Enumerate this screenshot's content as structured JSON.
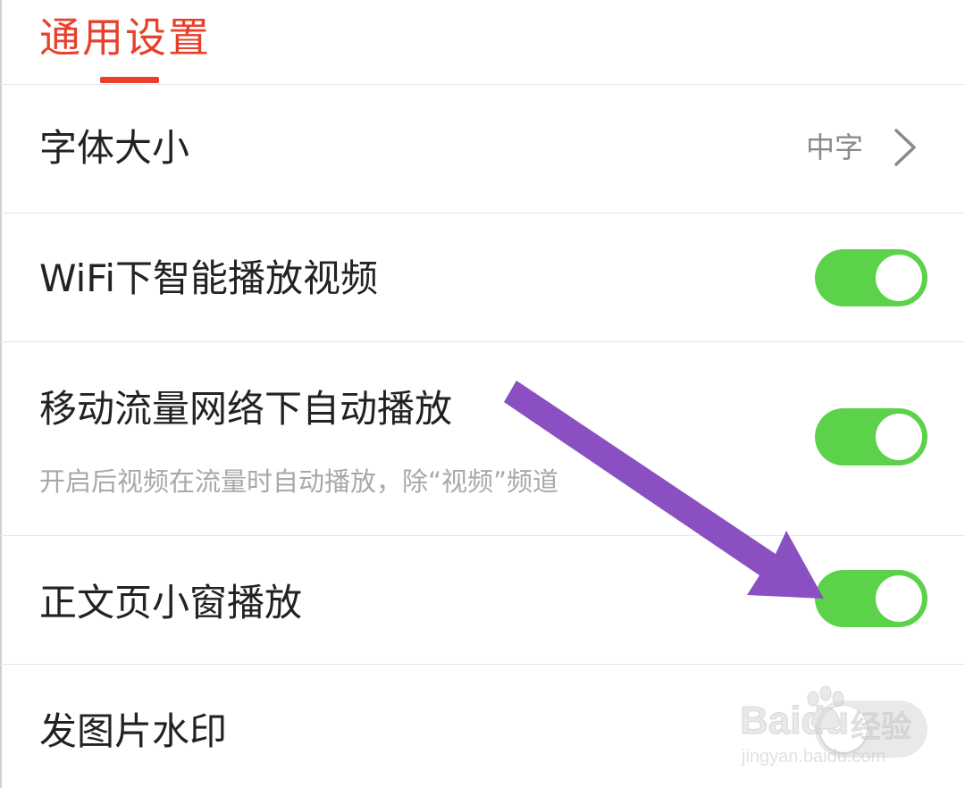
{
  "header": {
    "title": "通用设置"
  },
  "rows": [
    {
      "label": "字体大小",
      "value": "中字"
    },
    {
      "label": "WiFi下智能播放视频",
      "toggle": "on"
    },
    {
      "label": "移动流量网络下自动播放",
      "sublabel": "开启后视频在流量时自动播放，除“视频”频道",
      "toggle": "on"
    },
    {
      "label": "正文页小窗播放",
      "toggle": "on"
    },
    {
      "label": "发图片水印",
      "toggle": "off"
    }
  ],
  "watermark": {
    "brand": "Baidu",
    "suffix": "经验",
    "url": "jingyan.baidu.com"
  },
  "colors": {
    "accent": "#e8402a",
    "toggle_on": "#5bd24a",
    "annotation_arrow": "#8a4fc0"
  }
}
